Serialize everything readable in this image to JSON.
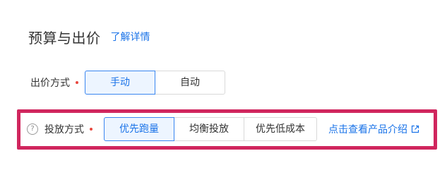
{
  "header": {
    "title": "预算与出价",
    "learn_more": "了解详情"
  },
  "bid_method": {
    "label": "出价方式",
    "options": [
      "手动",
      "自动"
    ],
    "selected": "手动"
  },
  "delivery_method": {
    "label": "投放方式",
    "help_icon": "question-circle-icon",
    "options": [
      "优先跑量",
      "均衡投放",
      "优先低成本"
    ],
    "selected": "优先跑量",
    "intro_link": "点击查看产品介绍",
    "intro_icon": "external-link-icon"
  },
  "colors": {
    "accent": "#1a73e8",
    "required": "#e8473e",
    "highlight": "#d0265e"
  }
}
